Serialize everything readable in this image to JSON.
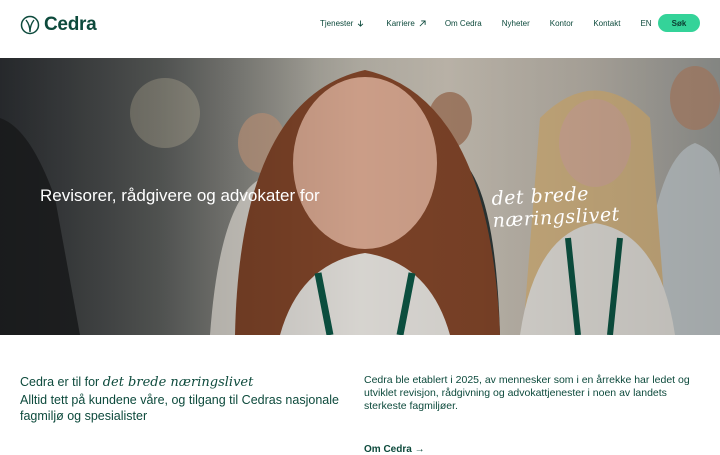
{
  "brand": {
    "name": "Cedra"
  },
  "nav": {
    "items": [
      {
        "label": "Tjenester",
        "icon": "arrow-down-icon"
      },
      {
        "label": "Karriere",
        "icon": "arrow-up-right-icon"
      },
      {
        "label": "Om Cedra"
      },
      {
        "label": "Nyheter"
      },
      {
        "label": "Kontor"
      },
      {
        "label": "Kontakt"
      },
      {
        "label": "EN"
      }
    ],
    "search_label": "Søk"
  },
  "hero": {
    "headline": "Revisorer, rådgivere og advokater for",
    "script": "det brede næringslivet"
  },
  "intro": {
    "lead": "Cedra er til for",
    "lead_script": "det brede næringslivet",
    "body": "Alltid tett på kundene våre, og tilgang til Cedras nasjonale fagmiljø og spesialister"
  },
  "about": {
    "text": "Cedra ble etablert i 2025, av mennesker som i en årrekke har ledet og utviklet revisjon, rådgivning og advokattjenester i noen av landets sterkeste fagmiljøer."
  },
  "colors": {
    "primary": "#0d4a3c",
    "accent": "#34d399"
  }
}
